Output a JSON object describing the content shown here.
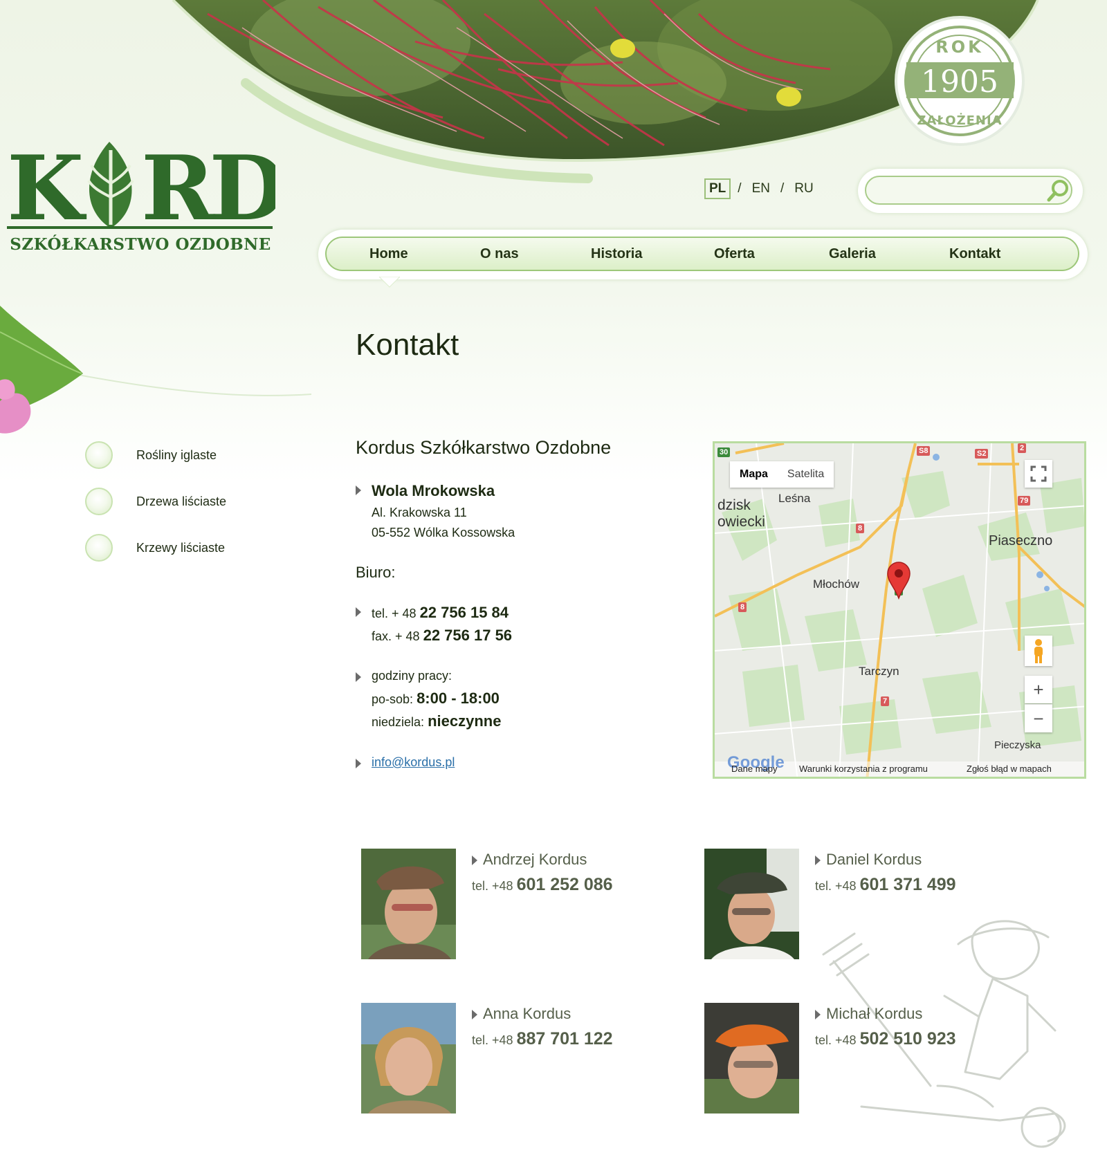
{
  "header": {
    "logo": {
      "wordmark": "KORDUS",
      "subtitle": "SZKÓŁKARSTWO OZDOBNE"
    },
    "badge": {
      "top": "ROK",
      "year": "1905",
      "bottom": "ZAŁOŻENIA"
    },
    "languages": [
      {
        "code": "PL",
        "active": true
      },
      {
        "code": "EN",
        "active": false
      },
      {
        "code": "RU",
        "active": false
      }
    ],
    "lang_separator": "/",
    "search": {
      "placeholder": "",
      "icon": "search-icon"
    }
  },
  "nav": {
    "items": [
      "Home",
      "O nas",
      "Historia",
      "Oferta",
      "Galeria",
      "Kontakt"
    ],
    "active": "Home"
  },
  "sidebar": {
    "items": [
      "Rośliny iglaste",
      "Drzewa liściaste",
      "Krzewy liściaste"
    ]
  },
  "main": {
    "title": "Kontakt",
    "company": "Kordus Szkółkarstwo Ozdobne",
    "location": {
      "name": "Wola Mrokowska",
      "street": "Al. Krakowska 11",
      "city": "05-552 Wólka Kossowska"
    },
    "office_heading": "Biuro:",
    "tel_prefix": "tel. + 48",
    "tel_number": "22 756 15 84",
    "fax_prefix": "fax. + 48",
    "fax_number": "22 756 17 56",
    "hours_label": "godziny pracy:",
    "weekday_label": "po-sob:",
    "weekday_hours": "8:00 - 18:00",
    "sunday_label": "niedziela:",
    "sunday_hours": "nieczynne",
    "email": "info@kordus.pl"
  },
  "map": {
    "type_buttons": [
      "Mapa",
      "Satelita"
    ],
    "active_type": "Mapa",
    "places": [
      "dzisk",
      "owiecki",
      "Leśna",
      "Piaseczno",
      "Młochów",
      "Tarczyn",
      "Pieczyska"
    ],
    "road_badges": [
      "30",
      "S8",
      "S2",
      "2",
      "79",
      "8",
      "8",
      "7",
      "7"
    ],
    "footer": {
      "google": "Google",
      "data": "Dane mapy",
      "terms": "Warunki korzystania z programu",
      "report": "Zgłoś błąd w mapach"
    },
    "controls": {
      "fullscreen": "fullscreen-icon",
      "pegman": "pegman-icon",
      "zoom_in": "+",
      "zoom_out": "−"
    }
  },
  "people": [
    {
      "name": "Andrzej Kordus",
      "tel_prefix": "tel. +48",
      "tel": "601 252 086"
    },
    {
      "name": "Daniel Kordus",
      "tel_prefix": "tel. +48",
      "tel": "601 371 499"
    },
    {
      "name": "Anna Kordus",
      "tel_prefix": "tel. +48",
      "tel": "887 701 122"
    },
    {
      "name": "Michał Kordus",
      "tel_prefix": "tel. +48",
      "tel": "502 510 923"
    }
  ],
  "colors": {
    "brand_green": "#2f6a2a",
    "nav_border": "#9dc77a",
    "link": "#2a6fa8",
    "text": "#1d2a12"
  }
}
